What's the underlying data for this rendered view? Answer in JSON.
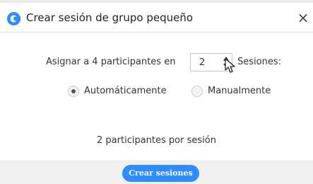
{
  "dialog": {
    "title": "Crear sesión de grupo pequeño",
    "close_label": "×"
  },
  "assign": {
    "prefix": "Asignar a 4 participantes en",
    "sessions_count": "2",
    "suffix": "Sesiones:"
  },
  "mode": {
    "automatic_label": "Automáticamente",
    "manual_label": "Manualmente",
    "selected": "automatic"
  },
  "summary_text": "2 participantes por sesión",
  "footer": {
    "create_button_label": "Crear sesiones"
  },
  "colors": {
    "accent": "#2d8cff",
    "footer_bg": "#f1f1f1"
  },
  "icons": {
    "app_logo": "zoom-logo-icon",
    "close": "close-icon",
    "stepper_up": "arrow-up-icon",
    "stepper_down": "arrow-down-icon",
    "pointer": "mouse-cursor-icon"
  }
}
